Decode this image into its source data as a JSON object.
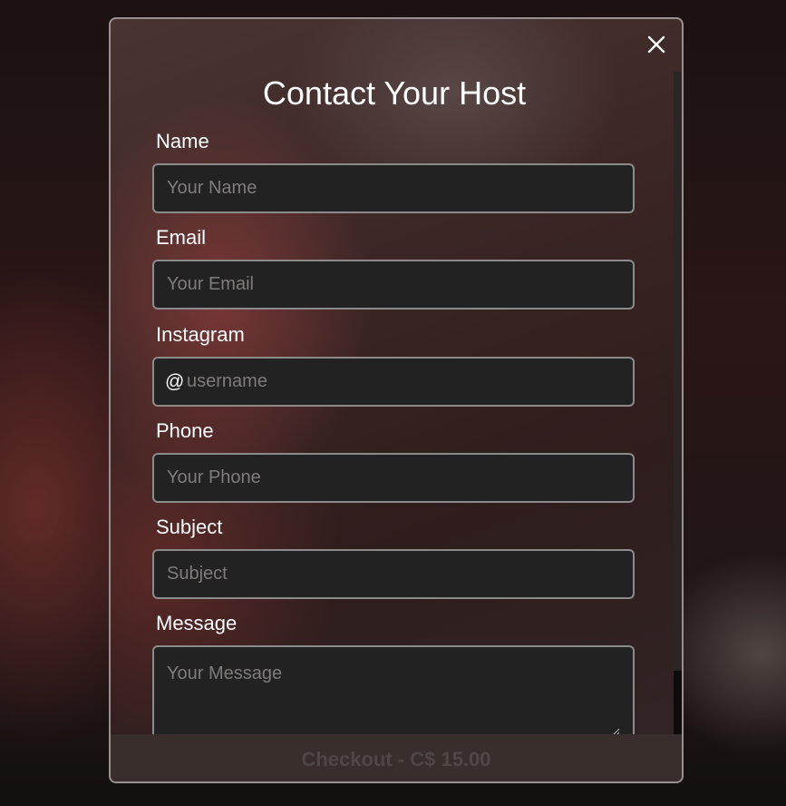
{
  "modal": {
    "title": "Contact Your Host",
    "close_icon": "close-icon"
  },
  "form": {
    "name": {
      "label": "Name",
      "placeholder": "Your Name",
      "value": ""
    },
    "email": {
      "label": "Email",
      "placeholder": "Your Email",
      "value": ""
    },
    "instagram": {
      "label": "Instagram",
      "prefix": "@",
      "placeholder": "username",
      "value": ""
    },
    "phone": {
      "label": "Phone",
      "placeholder": "Your Phone",
      "value": ""
    },
    "subject": {
      "label": "Subject",
      "placeholder": "Subject",
      "value": ""
    },
    "message": {
      "label": "Message",
      "placeholder": "Your Message",
      "value": ""
    }
  },
  "footer": {
    "checkout_label": "Checkout - C$ 15.00"
  },
  "colors": {
    "field_bg": "#232222",
    "field_border": "#8d8a8a",
    "placeholder": "#7e7b7b",
    "text": "#ffffff"
  }
}
